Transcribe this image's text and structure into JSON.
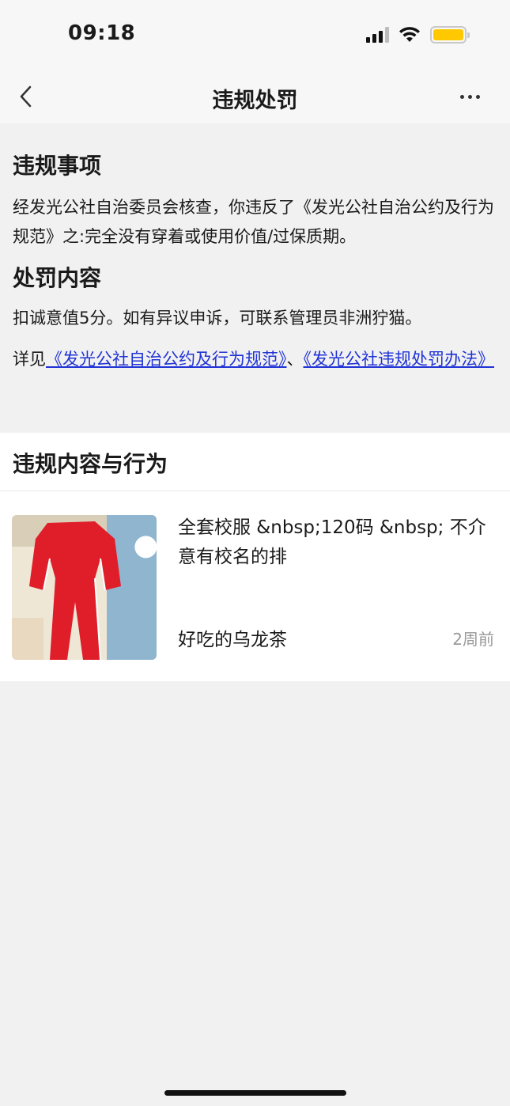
{
  "status_bar": {
    "time": "09:18",
    "battery_color": "#ffc800"
  },
  "nav": {
    "title": "违规处罚",
    "back_icon": "chevron-left-icon",
    "more_icon": "more-dots-icon"
  },
  "violation": {
    "heading": "违规事项",
    "text": "经发光公社自治委员会核查，你违反了《发光公社自治公约及行为规范》之:完全没有穿着或使用价值/过保质期。"
  },
  "penalty": {
    "heading": "处罚内容",
    "text": "扣诚意值5分。如有异议申诉，可联系管理员非洲狞猫。",
    "see_prefix": "详见",
    "link1": "《发光公社自治公约及行为规范》",
    "separator": "、",
    "link2": "《发光公社违规处罚办法》",
    "link_color": "#2033d6"
  },
  "content_section": {
    "title": "违规内容与行为"
  },
  "item": {
    "title": "全套校服 &nbsp;120码 &nbsp; 不介意有校名的排",
    "user": "好吃的乌龙茶",
    "time": "2周前",
    "image": "red-tracksuit-photo"
  }
}
